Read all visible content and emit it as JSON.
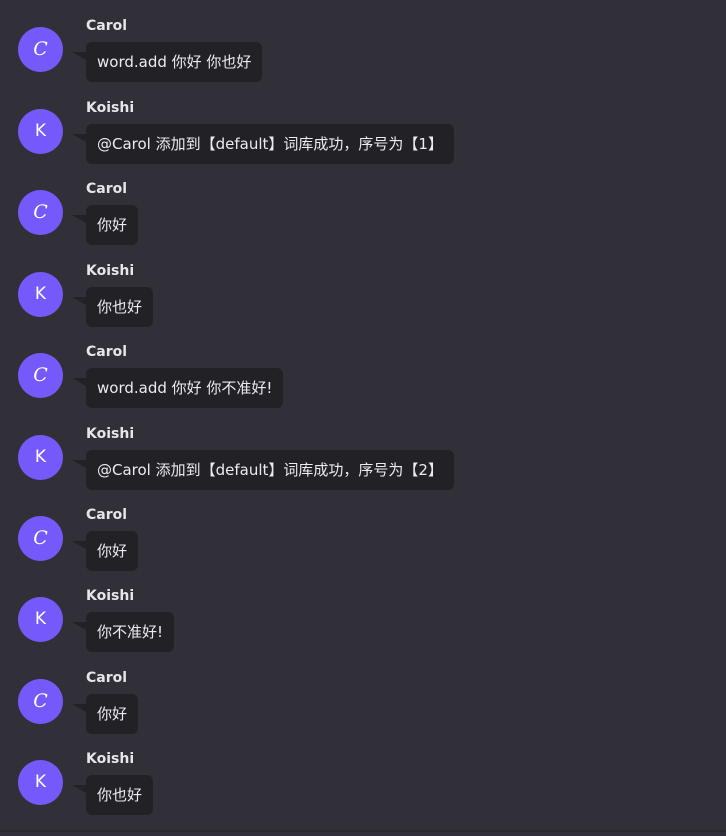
{
  "colors": {
    "background": "#313038",
    "bubble": "#222226",
    "avatar": "#7559fa",
    "text": "#ececf0"
  },
  "messages": [
    {
      "avatar": "C",
      "sender": "Carol",
      "text": "word.add 你好 你也好"
    },
    {
      "avatar": "K",
      "sender": "Koishi",
      "text": "@Carol 添加到【default】词库成功，序号为【1】"
    },
    {
      "avatar": "C",
      "sender": "Carol",
      "text": "你好"
    },
    {
      "avatar": "K",
      "sender": "Koishi",
      "text": "你也好"
    },
    {
      "avatar": "C",
      "sender": "Carol",
      "text": "word.add 你好 你不准好!"
    },
    {
      "avatar": "K",
      "sender": "Koishi",
      "text": "@Carol 添加到【default】词库成功，序号为【2】"
    },
    {
      "avatar": "C",
      "sender": "Carol",
      "text": "你好"
    },
    {
      "avatar": "K",
      "sender": "Koishi",
      "text": "你不准好!"
    },
    {
      "avatar": "C",
      "sender": "Carol",
      "text": "你好"
    },
    {
      "avatar": "K",
      "sender": "Koishi",
      "text": "你也好"
    }
  ]
}
